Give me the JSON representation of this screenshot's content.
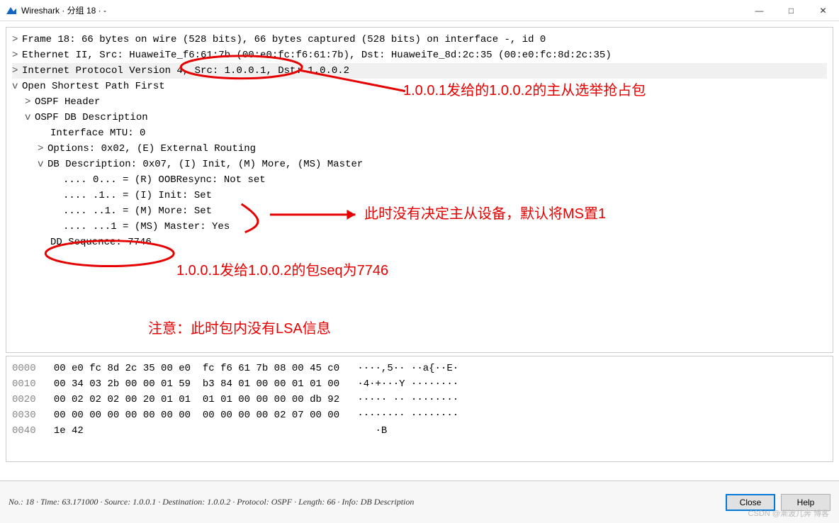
{
  "window": {
    "title": "Wireshark · 分组 18 · -",
    "minimize": "—",
    "maximize": "□",
    "close": "✕"
  },
  "tree": {
    "frame": "Frame 18: 66 bytes on wire (528 bits), 66 bytes captured (528 bits) on interface -, id 0",
    "eth": "Ethernet II, Src: HuaweiTe_f6:61:7b (00:e0:fc:f6:61:7b), Dst: HuaweiTe_8d:2c:35 (00:e0:fc:8d:2c:35)",
    "ip": "Internet Protocol Version 4, Src: 1.0.0.1, Dst: 1.0.0.2",
    "ospf": "Open Shortest Path First",
    "ospf_header": "OSPF Header",
    "ospf_dbd": "OSPF DB Description",
    "mtu": "Interface MTU: 0",
    "options": "Options: 0x02, (E) External Routing",
    "dbd_flags": "DB Description: 0x07, (I) Init, (M) More, (MS) Master",
    "flag_r": ".... 0... = (R) OOBResync: Not set",
    "flag_i": ".... .1.. = (I) Init: Set",
    "flag_m": ".... ..1. = (M) More: Set",
    "flag_ms": ".... ...1 = (MS) Master: Yes",
    "dd_seq": "DD Sequence: 7746"
  },
  "hex": {
    "rows": [
      {
        "addr": "0000",
        "bytes": "00 e0 fc 8d 2c 35 00 e0  fc f6 61 7b 08 00 45 c0",
        "ascii": "····,5·· ··a{··E·"
      },
      {
        "addr": "0010",
        "bytes": "00 34 03 2b 00 00 01 59  b3 84 01 00 00 01 01 00",
        "ascii": "·4·+···Y ········"
      },
      {
        "addr": "0020",
        "bytes": "00 02 02 02 00 20 01 01  01 01 00 00 00 00 db 92",
        "ascii": "····· ·· ········"
      },
      {
        "addr": "0030",
        "bytes": "00 00 00 00 00 00 00 00  00 00 00 00 02 07 00 00",
        "ascii": "········ ········"
      },
      {
        "addr": "0040",
        "bytes": "1e 42",
        "ascii": "·B"
      }
    ]
  },
  "annotations": {
    "a1": "1.0.0.1发给的1.0.0.2的主从选举抢占包",
    "a2": "此时没有决定主从设备，默认将MS置1",
    "a3": "1.0.0.1发给1.0.0.2的包seq为7746",
    "a4": "注意：此时包内没有LSA信息"
  },
  "status": "No.: 18 · Time: 63.171000 · Source: 1.0.0.1 · Destination: 1.0.0.2 · Protocol: OSPF · Length: 66 · Info: DB Description",
  "buttons": {
    "close": "Close",
    "help": "Help"
  },
  "watermark": "CSDN @漸波儿奔 博客"
}
